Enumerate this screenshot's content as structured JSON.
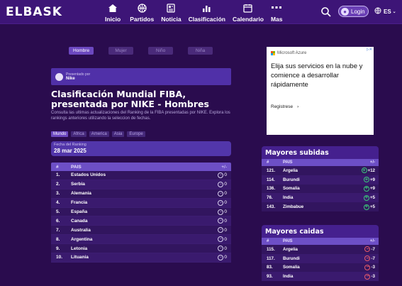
{
  "header": {
    "logo": "ELBASK",
    "nav": [
      {
        "label": "Inicio",
        "icon": "home-icon"
      },
      {
        "label": "Partidos",
        "icon": "basketball-icon"
      },
      {
        "label": "Noticia",
        "icon": "news-icon"
      },
      {
        "label": "Clasificación",
        "icon": "bar-chart-icon"
      },
      {
        "label": "Calendario",
        "icon": "calendar-icon"
      },
      {
        "label": "Mas",
        "icon": "more-icon"
      }
    ],
    "login_label": "Login",
    "language": "ES"
  },
  "tabs": [
    {
      "label": "Hombre",
      "active": true
    },
    {
      "label": "Mujer",
      "active": false
    },
    {
      "label": "Niño",
      "active": false
    },
    {
      "label": "Niña",
      "active": false
    }
  ],
  "sponsor": {
    "presented_by": "Presentado por",
    "name": "Nike"
  },
  "title": "Clasificación Mundial FIBA, presentada por NIKE - Hombres",
  "description": "Consulta las ultimas actualizaciones del Ranking de la FIBA presentadas por NIKE. Explora los rankings anteriores utilizando la seleccion de fechas.",
  "regions": [
    {
      "label": "Mundo",
      "active": true
    },
    {
      "label": "Africa",
      "active": false
    },
    {
      "label": "America",
      "active": false
    },
    {
      "label": "Asia",
      "active": false
    },
    {
      "label": "Europe",
      "active": false
    }
  ],
  "ranking_date": {
    "label": "Fecha del Ranking",
    "value": "28 mar 2025"
  },
  "ranking_table": {
    "headers": {
      "rank": "#",
      "country": "PAIS",
      "change": "+/-"
    },
    "rows": [
      {
        "rank": "1.",
        "country": "Estados Unidos",
        "change": "0"
      },
      {
        "rank": "2.",
        "country": "Serbia",
        "change": "0"
      },
      {
        "rank": "3.",
        "country": "Alemania",
        "change": "0"
      },
      {
        "rank": "4.",
        "country": "Francia",
        "change": "0"
      },
      {
        "rank": "5.",
        "country": "España",
        "change": "0"
      },
      {
        "rank": "6.",
        "country": "Canada",
        "change": "0"
      },
      {
        "rank": "7.",
        "country": "Australia",
        "change": "0"
      },
      {
        "rank": "8.",
        "country": "Argentina",
        "change": "0"
      },
      {
        "rank": "9.",
        "country": "Letonia",
        "change": "0"
      },
      {
        "rank": "10.",
        "country": "Lituania",
        "change": "0"
      }
    ]
  },
  "ad": {
    "brand": "Microsoft Azure",
    "headline": "Elija sus servicios en la nube y comience a desarrollar rápidamente",
    "cta": "Registrese",
    "colors": [
      "#f25022",
      "#7fba00",
      "#00a4ef",
      "#ffb900"
    ]
  },
  "top_risers": {
    "title": "Mayores subidas",
    "headers": {
      "rank": "#",
      "country": "PAIS",
      "change": "+/-"
    },
    "rows": [
      {
        "rank": "121.",
        "country": "Argelia",
        "change": "+12"
      },
      {
        "rank": "114.",
        "country": "Burundi",
        "change": "+9"
      },
      {
        "rank": "136.",
        "country": "Somalia",
        "change": "+9"
      },
      {
        "rank": "76.",
        "country": "India",
        "change": "+5"
      },
      {
        "rank": "143.",
        "country": "Zimbabue",
        "change": "+5"
      }
    ]
  },
  "top_fallers": {
    "title": "Mayores caidas",
    "headers": {
      "rank": "#",
      "country": "PAIS",
      "change": "+/-"
    },
    "rows": [
      {
        "rank": "115.",
        "country": "Argelia",
        "change": "-7"
      },
      {
        "rank": "117.",
        "country": "Burundi",
        "change": "-7"
      },
      {
        "rank": "83.",
        "country": "Somalia",
        "change": "-3"
      },
      {
        "rank": "93.",
        "country": "India",
        "change": "-3"
      }
    ]
  }
}
